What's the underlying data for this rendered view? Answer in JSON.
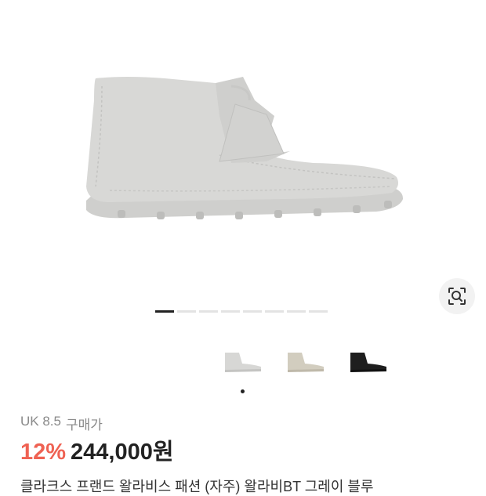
{
  "gallery": {
    "page_count": 8,
    "current_page": 1,
    "lens_icon": "image-search-icon",
    "thumbnails": [
      {
        "name": "grey-boot",
        "color": "#d7d7d5"
      },
      {
        "name": "sand-boot",
        "color": "#d2cdbf"
      },
      {
        "name": "black-boot",
        "color": "#1e1e1e"
      }
    ],
    "selected_thumbnail": 1
  },
  "product": {
    "size_label": "UK 8.5",
    "price_type": "구매가",
    "discount": "12%",
    "price": "244,000원",
    "title": "클라크스 프랜드 왈라비스 패션 (자주) 왈라비BT 그레이 블루"
  },
  "colors": {
    "discount": "#ef6253",
    "boot_main": "#d5d5d3",
    "sole": "#cfcfcd"
  }
}
